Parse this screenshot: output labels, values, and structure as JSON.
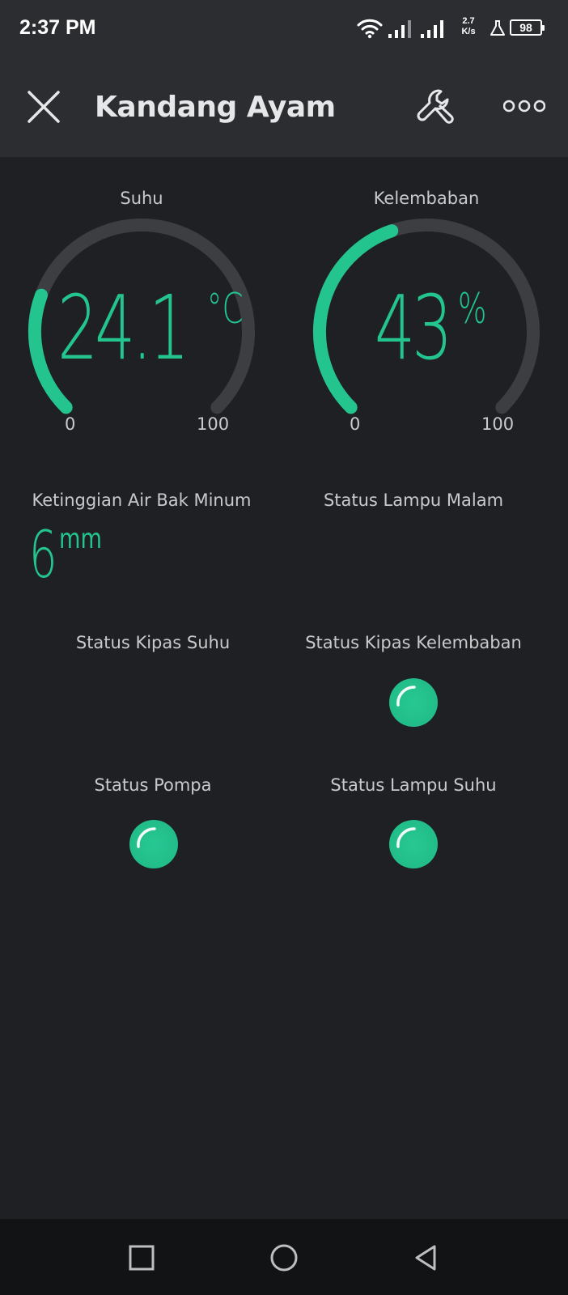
{
  "status_bar": {
    "time": "2:37 PM",
    "net_speed_value": "2.7",
    "net_speed_unit": "K/s",
    "battery": "98",
    "icons": [
      "wifi-icon",
      "signal-icon",
      "signal-icon",
      "flask-icon",
      "battery-icon"
    ]
  },
  "header": {
    "title": "Kandang Ayam",
    "icons": [
      "close-icon",
      "wrench-icon",
      "more-horizontal-icon"
    ]
  },
  "widgets": {
    "suhu": {
      "label": "Suhu",
      "value": "24.1",
      "unit": "°C",
      "min": "0",
      "max": "100",
      "fill_fraction": 0.241
    },
    "kelembaban": {
      "label": "Kelembaban",
      "value": "43",
      "unit": "%",
      "min": "0",
      "max": "100",
      "fill_fraction": 0.43
    },
    "ketinggian_air": {
      "label": "Ketinggian Air Bak Minum",
      "value": "6",
      "unit": "mm"
    },
    "lampu_malam": {
      "label": "Status Lampu Malam",
      "led_on": false
    },
    "kipas_suhu": {
      "label": "Status Kipas Suhu",
      "led_on": false
    },
    "kipas_kelembaban": {
      "label": "Status Kipas Kelembaban",
      "led_on": true
    },
    "pompa": {
      "label": "Status Pompa",
      "led_on": true
    },
    "lampu_suhu": {
      "label": "Status Lampu Suhu",
      "led_on": true
    }
  },
  "colors": {
    "accent": "#23c48e",
    "background": "#1f2023",
    "header": "#2c2d31",
    "gauge_track": "#3d3e42"
  },
  "nav_bar": {
    "icons": [
      "recent-apps-icon",
      "home-icon",
      "back-icon"
    ]
  }
}
